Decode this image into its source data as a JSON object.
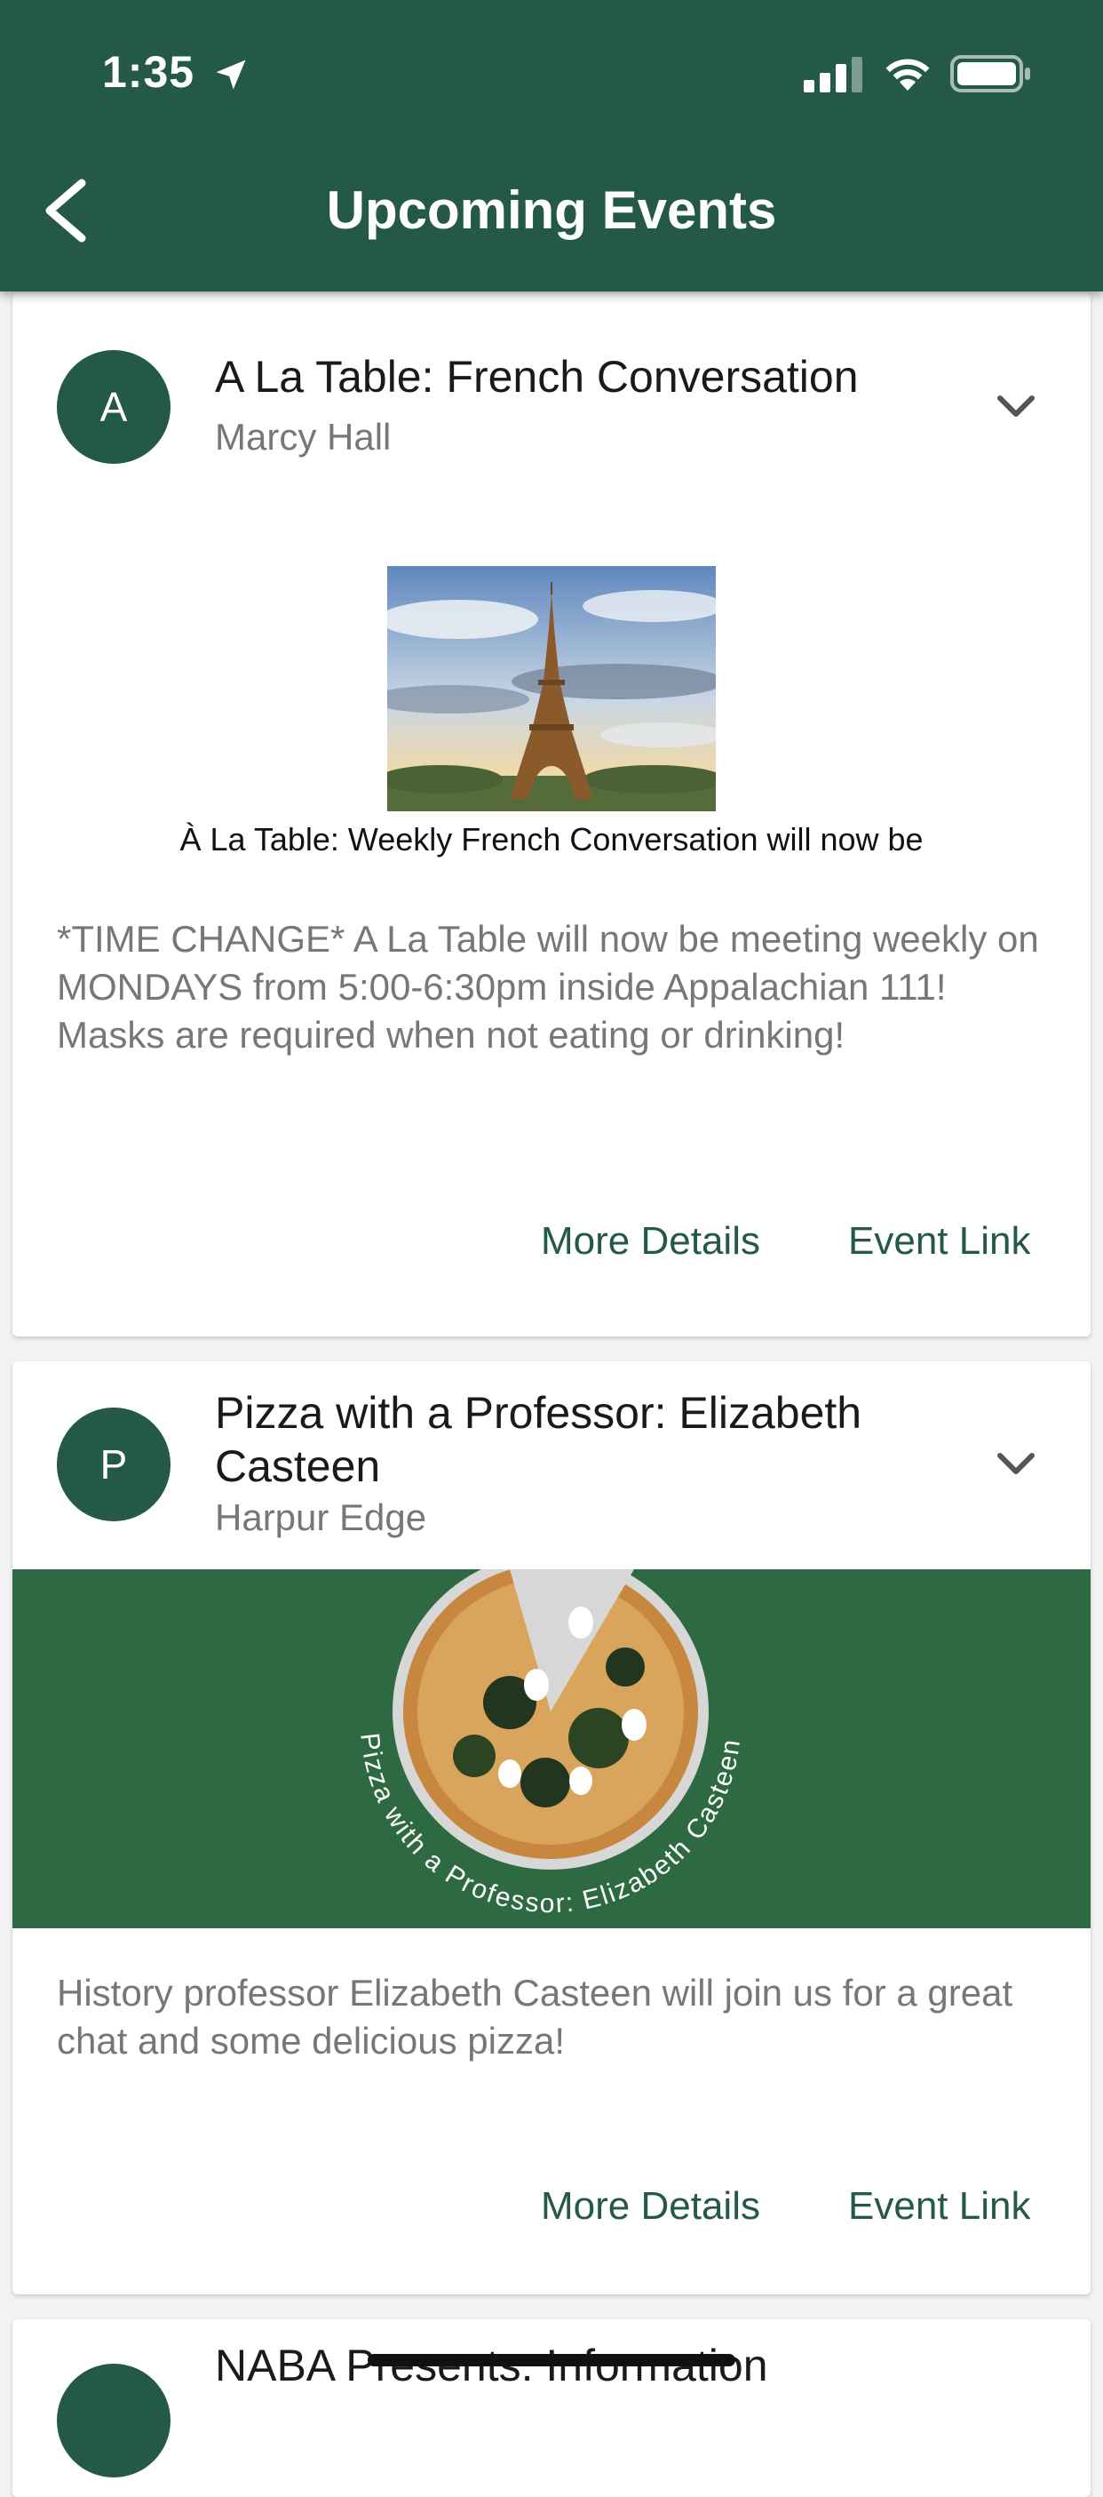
{
  "status_bar": {
    "time": "1:35"
  },
  "header": {
    "title": "Upcoming Events"
  },
  "events": [
    {
      "avatar_letter": "A",
      "title": "A La Table: French Conversation",
      "location": "Marcy Hall",
      "image_caption": "À La Table: Weekly French Conversation will now be",
      "description": "*TIME CHANGE* A La Table will now be meeting weekly on MONDAYS from 5:00-6:30pm inside Appalachian 111! Masks are required when not eating or drinking!",
      "more_details": "More Details",
      "event_link": "Event Link"
    },
    {
      "avatar_letter": "P",
      "title": "Pizza with a Professor: Elizabeth Casteen",
      "location": "Harpur Edge",
      "banner_text": "Pizza with a Professor: Elizabeth Casteen",
      "description": "History professor Elizabeth Casteen will join us for a great chat and some delicious pizza!",
      "more_details": "More Details",
      "event_link": "Event Link"
    },
    {
      "title": "NABA Presents: Information"
    }
  ],
  "colors": {
    "brand": "#245a45",
    "banner": "#2e6a41"
  }
}
